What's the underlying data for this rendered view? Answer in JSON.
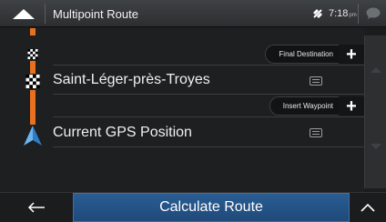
{
  "header": {
    "title": "Multipoint Route",
    "time": "7:18",
    "time_suffix": "pm"
  },
  "route": {
    "final_destination_label": "Final Destination",
    "insert_waypoint_label": "Insert Waypoint",
    "waypoints": [
      {
        "label": "Saint-Léger-près-Troyes",
        "icon": "checkered-flag-icon"
      },
      {
        "label": "Current GPS Position",
        "icon": "gps-arrow-icon"
      }
    ]
  },
  "bottom": {
    "calculate_label": "Calculate Route"
  },
  "colors": {
    "route_line": "#e8701e",
    "calc_button": "#2a5d93",
    "gps_arrow": "#4a9be0"
  }
}
